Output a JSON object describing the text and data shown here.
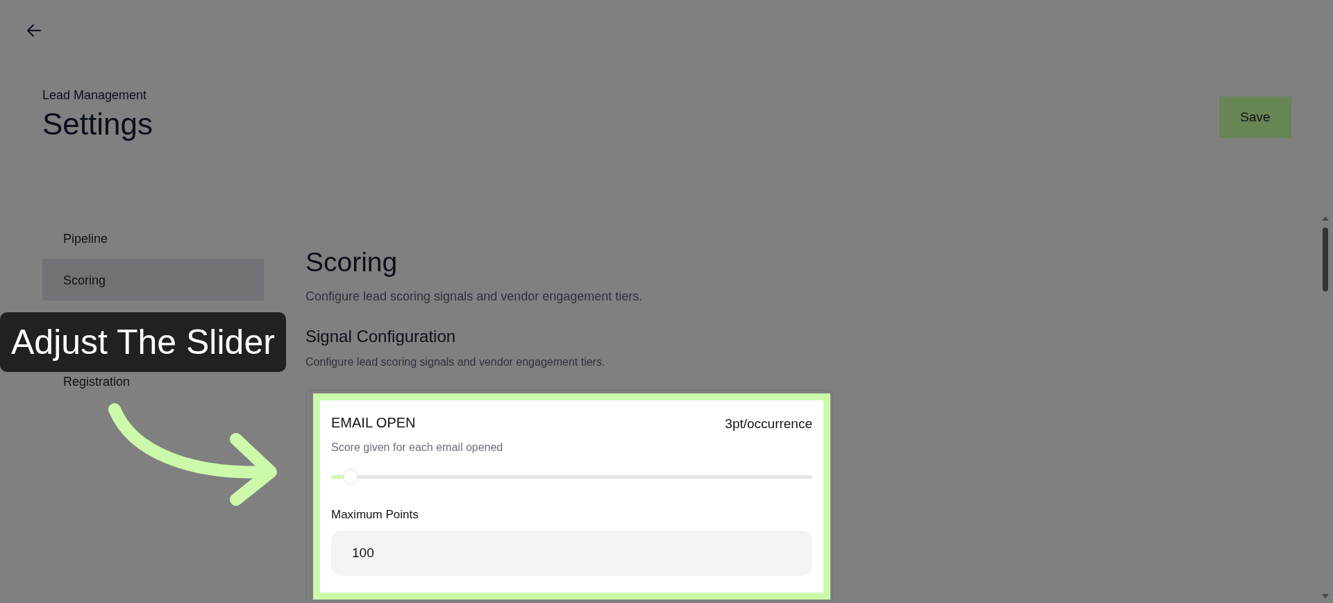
{
  "header": {
    "breadcrumb": "Lead Management",
    "title": "Settings",
    "save_button": "Save"
  },
  "sidebar": {
    "items": [
      {
        "label": "Pipeline",
        "selected": false
      },
      {
        "label": "Scoring",
        "selected": true
      },
      {
        "label": "Registration",
        "selected": false
      }
    ]
  },
  "section": {
    "title": "Scoring",
    "description": "Configure lead scoring signals and vendor engagement tiers.",
    "subsection_title": "Signal Configuration",
    "subsection_description": "Configure lead scoring signals and vendor engagement tiers."
  },
  "signals": [
    {
      "name": "EMAIL OPEN",
      "rate": "3pt/occurrence",
      "description": "Score given for each email opened",
      "level": 0.04,
      "max_label": "Maximum Points",
      "max_value": "100",
      "highlighted": true
    }
  ],
  "callout": {
    "text": "Adjust The Slider"
  }
}
